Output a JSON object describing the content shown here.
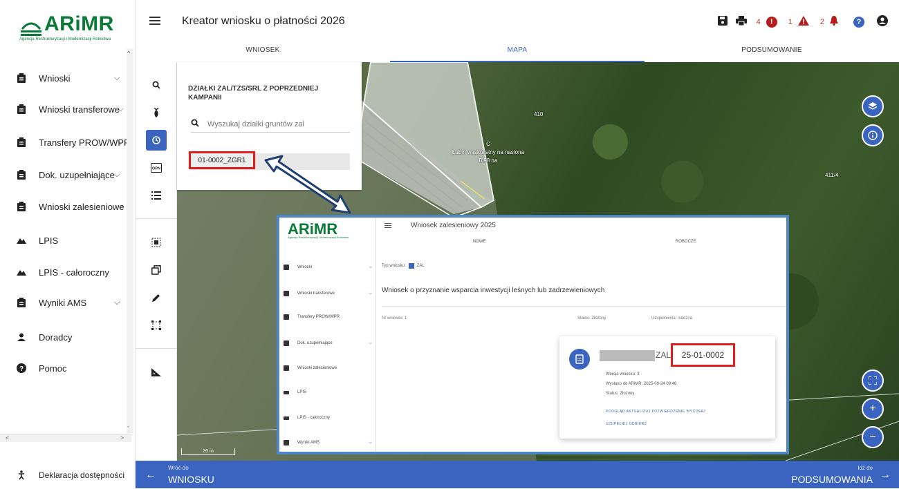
{
  "brand": {
    "logo": "ARiMR",
    "logo_sub": "Agencja Restrukturyzacji i Modernizacji Rolnictwa",
    "color": "#0a7a36"
  },
  "accent": "#3a64bf",
  "sidebar": {
    "items": [
      {
        "label": "Wnioski",
        "icon": "clipboard-icon",
        "chevron": true
      },
      {
        "label": "Wnioski transferowe",
        "icon": "clipboard-icon",
        "chevron": true
      },
      {
        "label": "Transfery PROW/WPR",
        "icon": "clipboard-icon",
        "chevron": true
      },
      {
        "label": "Dok. uzupełniające",
        "icon": "clipboard-icon",
        "chevron": true
      },
      {
        "label": "Wnioski zalesieniowe",
        "icon": "clipboard-icon",
        "chevron": true
      },
      {
        "label": "LPIS",
        "icon": "mountain-icon",
        "chevron": false
      },
      {
        "label": "LPIS - całoroczny",
        "icon": "mountain-icon",
        "chevron": false
      },
      {
        "label": "Wyniki AMS",
        "icon": "clipboard-icon",
        "chevron": true
      },
      {
        "label": "Doradcy",
        "icon": "person-icon",
        "chevron": false
      },
      {
        "label": "Pomoc",
        "icon": "help-icon",
        "chevron": false
      }
    ],
    "accessibility": "Deklaracja dostępności"
  },
  "header": {
    "title": "Kreator wniosku o płatności 2026",
    "counts": {
      "errors": "4",
      "warnings": "1",
      "notifications": "2"
    },
    "tabs": [
      "WNIOSEK",
      "MAPA",
      "PODSUMOWANIE"
    ],
    "active_tab": "MAPA"
  },
  "panel": {
    "title": "DZIAŁKI ZAL/TZS/SRL Z POPRZEDNIEJ KAMPANII",
    "search_placeholder": "Wyszukaj działki gruntów zal",
    "parcel": "01-0002_ZGR1"
  },
  "map": {
    "labels": {
      "parcel_410": "410",
      "parcel_411": "411/4",
      "field_letter": "C",
      "crop": "Łubin wąskolistny na nasiona",
      "area": "0.98 ha"
    },
    "scale": "20 m"
  },
  "inset": {
    "logo": "ARiMR",
    "title": "Wniosek zalesieniowy 2025",
    "tabs": [
      "NOWE",
      "ROBOCZE"
    ],
    "sidebar": [
      "Wnioski",
      "Wnioski transferowe",
      "Transfery PROW/WPR",
      "Dok. uzupełniające",
      "Wnioski zalesieniowe",
      "LPIS",
      "LPIS - całoroczny",
      "Wyniki AMS"
    ],
    "filter_label": "Typ wniosku:",
    "filter_value": "ZAL",
    "heading": "Wniosek o przyznanie wsparcia inwestycji leśnych lub zadrzewieniowych",
    "col_number": "Nr wniosku: 1",
    "col_status": "Status: Złożony",
    "col_extra": "Uzupełnienia: należna",
    "card": {
      "prefix": "ZAL",
      "number": "25-01-0002",
      "version": "Wersja wniosku: 3",
      "sent": "Wysłano do ARiMR: 2025-09-24 09:48",
      "status": "Status: Złożony",
      "links_1": "PODGLĄD   AKTUALIZUJ   POTWIERDZENIE   WYCOFAJ",
      "links_2": "UZUPEŁNIJ   ODBIERZ"
    }
  },
  "bottom": {
    "back_small": "Wróć do",
    "back_big": "WNIOSKU",
    "next_small": "Idź do",
    "next_big": "PODSUMOWANIA"
  }
}
